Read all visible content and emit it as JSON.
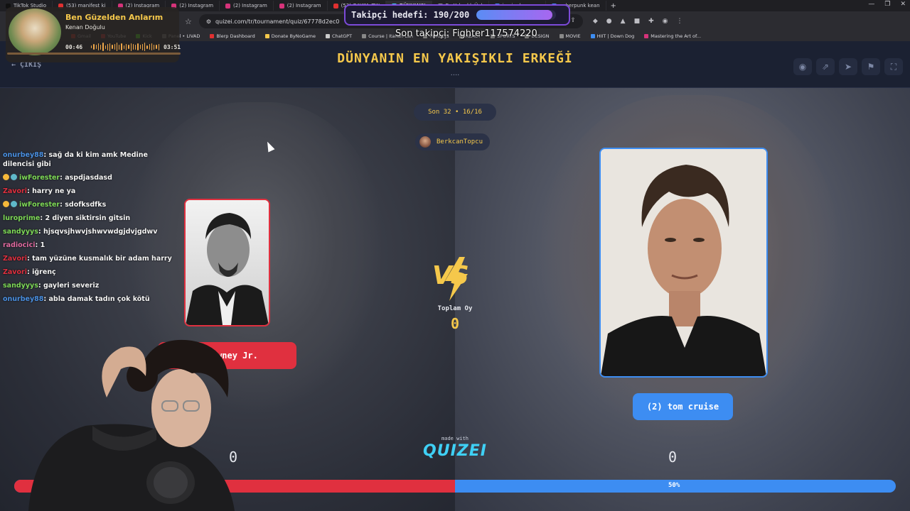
{
  "browser": {
    "tabs": [
      {
        "label": "TikTok Studio",
        "color": "#111"
      },
      {
        "label": "(53) manifest ki",
        "color": "#e03030"
      },
      {
        "label": "(2) Instagram",
        "color": "#d6337a"
      },
      {
        "label": "(2) Instagram",
        "color": "#d6337a"
      },
      {
        "label": "(2) Instagram",
        "color": "#d6337a"
      },
      {
        "label": "(2) Instagram",
        "color": "#d6337a"
      },
      {
        "label": "(53) GAYIM, TW",
        "color": "#e03030"
      },
      {
        "label": "DÜNYANIN",
        "color": "#3fd0f5",
        "active": true
      },
      {
        "label": "En Yakışıklı Ünl",
        "color": "#888"
      },
      {
        "label": "jamie dornan p",
        "color": "#4285f4"
      },
      {
        "label": "cyberpunk kean",
        "color": "#4285f4"
      }
    ],
    "new_tab": "+",
    "url": "quizei.com/tr/tournament/quiz/67778d2ec0",
    "bookmarks": [
      {
        "label": "Gmail",
        "color": "#d93025"
      },
      {
        "label": "YouTube",
        "color": "#e03030"
      },
      {
        "label": "Kick",
        "color": "#53fc18"
      },
      {
        "label": "Panel • LIVAD",
        "color": "#888"
      },
      {
        "label": "Blerp Dashboard",
        "color": "#e03030"
      },
      {
        "label": "Donate ByNoGame",
        "color": "#f5c84b"
      },
      {
        "label": "ChatGPT",
        "color": "#ccc"
      },
      {
        "label": "Course | Italian Lan",
        "color": "#888"
      },
      {
        "label": "THREEJS",
        "color": "#888"
      },
      {
        "label": "REACT",
        "color": "#888"
      },
      {
        "label": "SPORTS",
        "color": "#888"
      },
      {
        "label": "DESIGN",
        "color": "#888"
      },
      {
        "label": "MOVIE",
        "color": "#888"
      },
      {
        "label": "HIIT | Down Dog",
        "color": "#3d8df2"
      },
      {
        "label": "Mastering the Art of...",
        "color": "#d6337a"
      }
    ]
  },
  "overlay": {
    "song_title": "Ben Güzelden Anlarım",
    "song_artist": "Kenan Doğulu",
    "time_current": "00:46",
    "time_total": "03:51",
    "follow_goal_label": "Takipçi hedefi: 190/200",
    "follow_progress": 0.95,
    "last_follower": "Son takipçi: Fighter117574220"
  },
  "chat": [
    {
      "user": "onurbey88",
      "color": "#4a90e2",
      "text": "sağ da ki kim amk Medine dilencisi gibi",
      "badges": 0
    },
    {
      "user": "iwForester",
      "color": "#7ed957",
      "text": "aspdjasdasd",
      "badges": 2
    },
    {
      "user": "Zavori",
      "color": "#e0303f",
      "text": "harry ne ya",
      "badges": 0
    },
    {
      "user": "iwForester",
      "color": "#7ed957",
      "text": "sdofksdfks",
      "badges": 2
    },
    {
      "user": "luroprime",
      "color": "#7ed957",
      "text": "2 diyen siktirsin gitsin",
      "badges": 0
    },
    {
      "user": "sandyyys",
      "color": "#7ed957",
      "text": "hjsqvsjhwvjshwvwdgjdvjgdwv",
      "badges": 0
    },
    {
      "user": "radiocici",
      "color": "#e06aa0",
      "text": "1",
      "badges": 0
    },
    {
      "user": "Zavori",
      "color": "#e0303f",
      "text": "tam yüzüne kusmalık bir adam harry",
      "badges": 0
    },
    {
      "user": "Zavori",
      "color": "#e0303f",
      "text": "iğrenç",
      "badges": 0
    },
    {
      "user": "sandyyys",
      "color": "#7ed957",
      "text": "gayleri severiz",
      "badges": 0
    },
    {
      "user": "onurbey88",
      "color": "#4a90e2",
      "text": "abla damak tadın çok kötü",
      "badges": 0
    }
  ],
  "quiz": {
    "back_label": "ÇIKIŞ",
    "title": "DÜNYANIN EN YAKIŞIKLI ERKEĞİ",
    "title_dots": "....",
    "round": "Son 32 • 16/16",
    "author": "BerkcanTopcu",
    "vs": "VS",
    "total_votes_label": "Toplam Oy",
    "total_votes": "0",
    "left_name": "Robert Downey Jr.",
    "left_visible_name": "t Downey Jr.",
    "right_name": "(2) tom cruise",
    "left_score": "0",
    "right_score": "0",
    "made_with": "made with",
    "brand": "QUIZEI",
    "left_percent": 50,
    "right_percent_label": "50%",
    "colors": {
      "accent": "#f5c84b",
      "left": "#e0303f",
      "right": "#3d8df2",
      "brand": "#3fd0f5"
    }
  }
}
